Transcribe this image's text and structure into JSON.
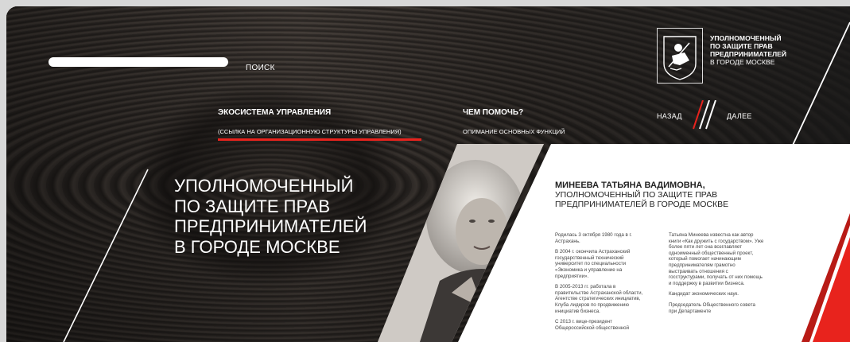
{
  "search": {
    "placeholder": "",
    "label": "ПОИСК"
  },
  "menu": {
    "items": [
      {
        "title": "ЭКОСИСТЕМА УПРАВЛЕНИЯ",
        "subtitle": "(ССЫЛКА НА ОРГАНИЗАЦИОННУЮ СТРУКТУРЫ УПРАВЛЕНИЯ)"
      },
      {
        "title": "ЧЕМ ПОМОЧЬ?",
        "subtitle": "ОПИМАНИЕ ОСНОВНЫХ ФУНКЦИЙ"
      }
    ]
  },
  "nav": {
    "back": "НАЗАД",
    "next": "ДАЛЕЕ"
  },
  "logo": {
    "lines": [
      "УПОЛНОМОЧЕННЫЙ",
      "ПО ЗАЩИТЕ ПРАВ",
      "ПРЕДПРИНИМАТЕЛЕЙ",
      "В ГОРОДЕ МОСКВЕ"
    ]
  },
  "hero": {
    "lines": [
      "УПОЛНОМОЧЕННЫЙ",
      "ПО ЗАЩИТЕ ПРАВ",
      "ПРЕДПРИНИМАТЕЛЕЙ",
      "В ГОРОДЕ МОСКВЕ"
    ]
  },
  "card": {
    "name": "МИНЕЕВА ТАТЬЯНА ВАДИМОВНА,",
    "position_lines": [
      "УПОЛНОМОЧЕННЫЙ ПО ЗАЩИТЕ ПРАВ",
      "ПРЕДПРИНИМАТЕЛЕЙ В ГОРОДЕ МОСКВЕ"
    ],
    "bio_left": [
      "Родилась 3 октября 1980 года в г. Астрахань.",
      "В 2004 г. окончила Астраханский государственный технический университет по специальности «Экономика и управление на предприятии».",
      "В 2005-2013 гг. работала в правительстве Астраханской области, Агентстве стратегических инициатив, Клуба лидеров по продвижению инициатив бизнеса.",
      "С 2013 г. вице-президент Общероссийской общественной"
    ],
    "bio_right": [
      "Татьяна Минеева известна как автор книги «Как дружить с государством». Уже более пяти лет она возглавляет одноименный общественный проект, который помогает начинающим предпринимателям грамотно выстраивать отношения с госструктурами, получать от них помощь и поддержку в развитии бизнеса.",
      "Кандидат экономических наук.",
      "Председатель Общественного совета при Департаменте"
    ]
  },
  "colors": {
    "accent": "#e8231d",
    "text_light": "#ffffff",
    "card_bg": "#ffffff"
  },
  "icons": {
    "logo": "moscow-coat-of-arms-icon",
    "nav_divider": "slashes-icon"
  }
}
